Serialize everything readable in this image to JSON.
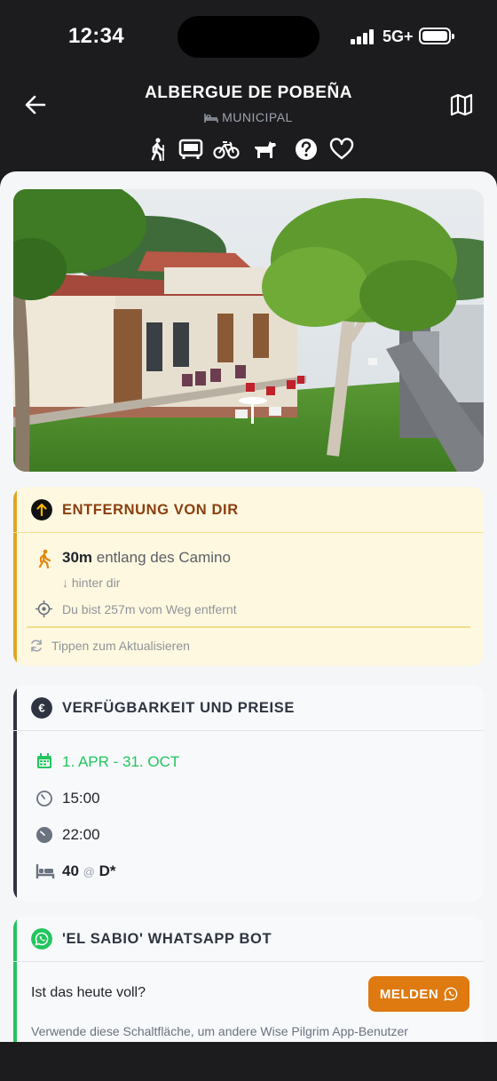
{
  "status_bar": {
    "time": "12:34",
    "network": "5G+"
  },
  "header": {
    "title": "ALBERGUE DE POBEÑA",
    "subtitle": "MUNICIPAL",
    "features": [
      "walker-icon",
      "bus-icon",
      "bicycle-icon",
      "dog-icon",
      "question-icon",
      "heart-icon"
    ]
  },
  "photo": {
    "subject": "albergue-building-photo"
  },
  "distance": {
    "title": "ENTFERNUNG VON DIR",
    "distance_value": "30m",
    "distance_suffix": " entlang des Camino",
    "direction": "↓ hinter dir",
    "off_route": "Du bist 257m vom Weg entfernt",
    "refresh": "Tippen zum Aktualisieren",
    "accent_color": "#e0a526"
  },
  "prices": {
    "title": "VERFÜGBARKEIT UND PREISE",
    "season": "1. APR - 31. OCT",
    "open_time": "15:00",
    "close_time": "22:00",
    "beds": "40",
    "at": "@",
    "bed_type": "D*",
    "season_color": "#22c55e"
  },
  "bot": {
    "title": "'EL SABIO' WHATSAPP BOT",
    "question": "Ist das heute voll?",
    "report_label": "MELDEN",
    "description": "Verwende diese Schaltfläche, um andere Wise Pilgrim App-Benutzer",
    "accent_color": "#22c55e",
    "button_color": "#de7a10"
  }
}
